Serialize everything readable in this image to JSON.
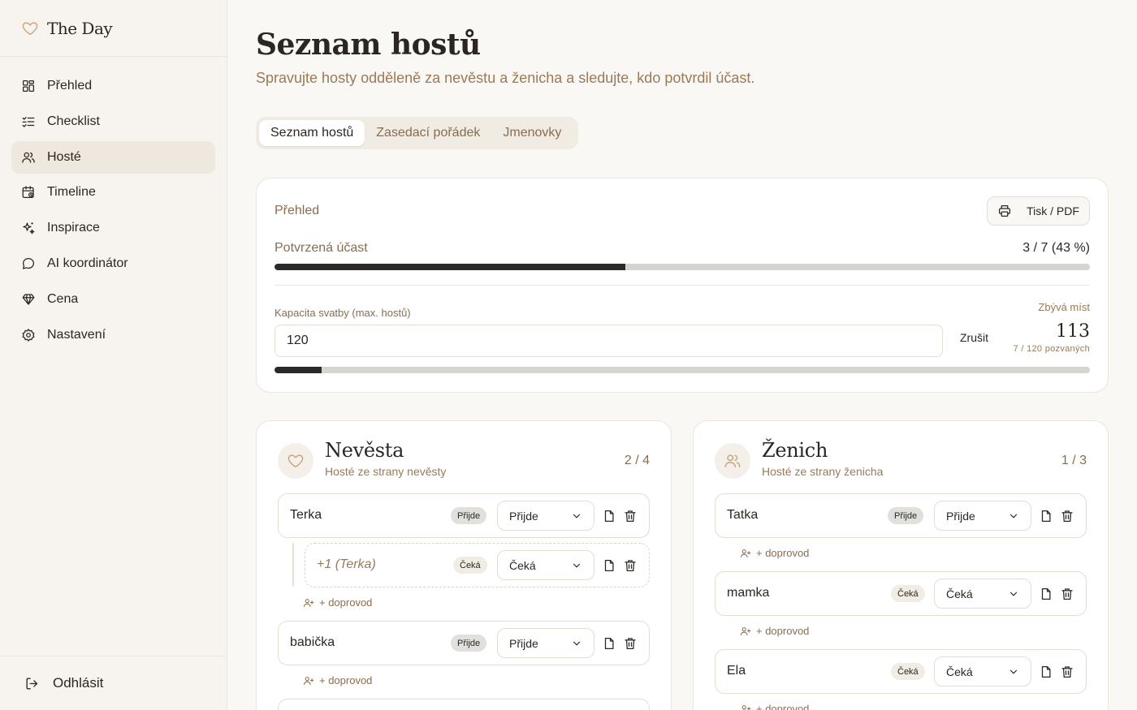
{
  "app": {
    "name": "The Day"
  },
  "sidebar": {
    "items": [
      {
        "label": "Přehled",
        "icon": "dashboard-icon",
        "active": false
      },
      {
        "label": "Checklist",
        "icon": "checklist-icon",
        "active": false
      },
      {
        "label": "Hosté",
        "icon": "users-icon",
        "active": true
      },
      {
        "label": "Timeline",
        "icon": "calendar-clock-icon",
        "active": false
      },
      {
        "label": "Inspirace",
        "icon": "sparkles-icon",
        "active": false
      },
      {
        "label": "AI koordinátor",
        "icon": "chat-bubble-icon",
        "active": false
      },
      {
        "label": "Cena",
        "icon": "gem-icon",
        "active": false
      },
      {
        "label": "Nastavení",
        "icon": "gear-icon",
        "active": false
      }
    ],
    "logout_label": "Odhlásit"
  },
  "page": {
    "title": "Seznam hostů",
    "subtitle": "Spravujte hosty odděleně za nevěstu a ženicha a sledujte, kdo potvrdil účast."
  },
  "tabs": [
    {
      "label": "Seznam hostů",
      "active": true
    },
    {
      "label": "Zasedací pořádek",
      "active": false
    },
    {
      "label": "Jmenovky",
      "active": false
    }
  ],
  "overview": {
    "label": "Přehled",
    "print_label": "Tisk / PDF",
    "confirmed_label": "Potvrzená účast",
    "confirmed_value": "3 / 7 (43 %)",
    "confirmed_fraction": 0.43,
    "capacity_label": "Kapacita svatby (max. hostů)",
    "capacity_value": "120",
    "cancel_label": "Zrušit",
    "remaining_label": "Zbývá míst",
    "remaining_value": "113",
    "remaining_sub": "7 / 120 pozvaných",
    "capacity_fraction": 0.058
  },
  "bride": {
    "title": "Nevěsta",
    "subtitle": "Hosté ze strany nevěsty",
    "count": "2 / 4",
    "add_companion_label": "+ doprovod",
    "guests": [
      {
        "name": "Terka",
        "badge": "Přijde",
        "status": "Přijde"
      },
      {
        "name": "+1 (Terka)",
        "badge": "Čeká",
        "status": "Čeká"
      },
      {
        "name": "babička",
        "badge": "Přijde",
        "status": "Přijde"
      }
    ]
  },
  "groom": {
    "title": "Ženich",
    "subtitle": "Hosté ze strany ženicha",
    "count": "1 / 3",
    "add_companion_label": "+ doprovod",
    "guests": [
      {
        "name": "Tatka",
        "badge": "Přijde",
        "status": "Přijde"
      },
      {
        "name": "mamka",
        "badge": "Čeká",
        "status": "Čeká"
      },
      {
        "name": "Ela",
        "badge": "Čeká",
        "status": "Čeká"
      }
    ]
  },
  "colors": {
    "accent": "#9a7a57",
    "bar_fill": "#2b2a29",
    "bar_track": "#d6d4d1",
    "background": "#faf8f5"
  }
}
